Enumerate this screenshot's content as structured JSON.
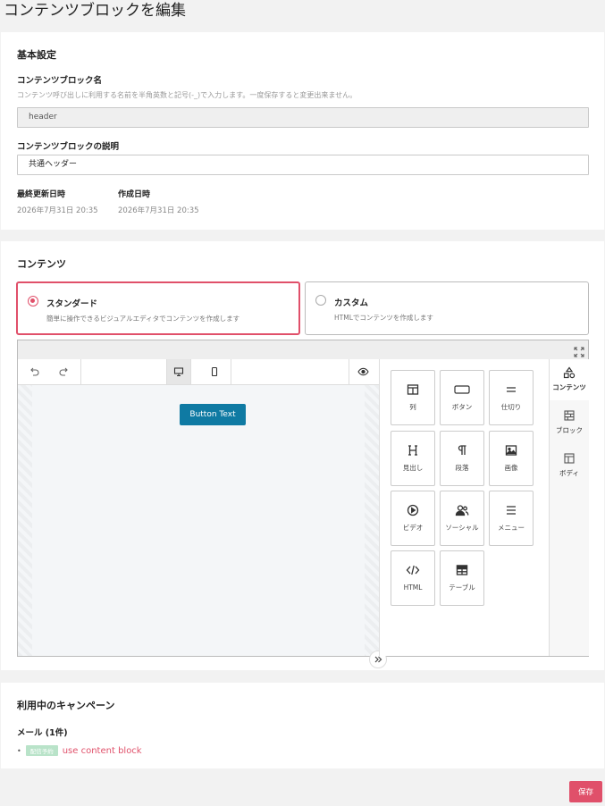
{
  "page": {
    "title": "コンテンツブロックを編集"
  },
  "basic": {
    "section_title": "基本設定",
    "name_label": "コンテンツブロック名",
    "name_hint": "コンテンツ呼び出しに利用する名前を半角英数と記号(-_)で入力します。一度保存すると変更出来ません。",
    "name_value": "header",
    "desc_label": "コンテンツブロックの説明",
    "desc_value": "共通ヘッダー",
    "updated_label": "最終更新日時",
    "updated_value": "2026年7月31日 20:35",
    "created_label": "作成日時",
    "created_value": "2026年7月31日 20:35"
  },
  "content": {
    "section_title": "コンテンツ",
    "modes": [
      {
        "title": "スタンダード",
        "desc": "簡単に操作できるビジュアルエディタでコンテンツを作成します",
        "selected": true
      },
      {
        "title": "カスタム",
        "desc": "HTMLでコンテンツを作成します",
        "selected": false
      }
    ],
    "canvas_button": "Button Text",
    "blocks": [
      {
        "label": "列",
        "icon": "columns-icon"
      },
      {
        "label": "ボタン",
        "icon": "button-icon"
      },
      {
        "label": "仕切り",
        "icon": "divider-icon"
      },
      {
        "label": "見出し",
        "icon": "heading-icon"
      },
      {
        "label": "段落",
        "icon": "paragraph-icon"
      },
      {
        "label": "画像",
        "icon": "image-icon"
      },
      {
        "label": "ビデオ",
        "icon": "video-icon"
      },
      {
        "label": "ソーシャル",
        "icon": "social-icon"
      },
      {
        "label": "メニュー",
        "icon": "menu-icon"
      },
      {
        "label": "HTML",
        "icon": "code-icon"
      },
      {
        "label": "テーブル",
        "icon": "table-icon"
      }
    ],
    "side_tabs": [
      {
        "label": "コンテンツ",
        "icon": "shapes-icon",
        "active": true
      },
      {
        "label": "ブロック",
        "icon": "blocks-icon",
        "active": false
      },
      {
        "label": "ボディ",
        "icon": "layout-icon",
        "active": false
      }
    ]
  },
  "campaigns": {
    "section_title": "利用中のキャンペーン",
    "mail_label": "メール (1件)",
    "items": [
      {
        "badge": "配信予約",
        "name": "use content block"
      }
    ]
  },
  "actions": {
    "save_label": "保存"
  },
  "colors": {
    "accent": "#e0506a",
    "canvas_button": "#0f7aa3",
    "badge": "#b9e3c9"
  }
}
